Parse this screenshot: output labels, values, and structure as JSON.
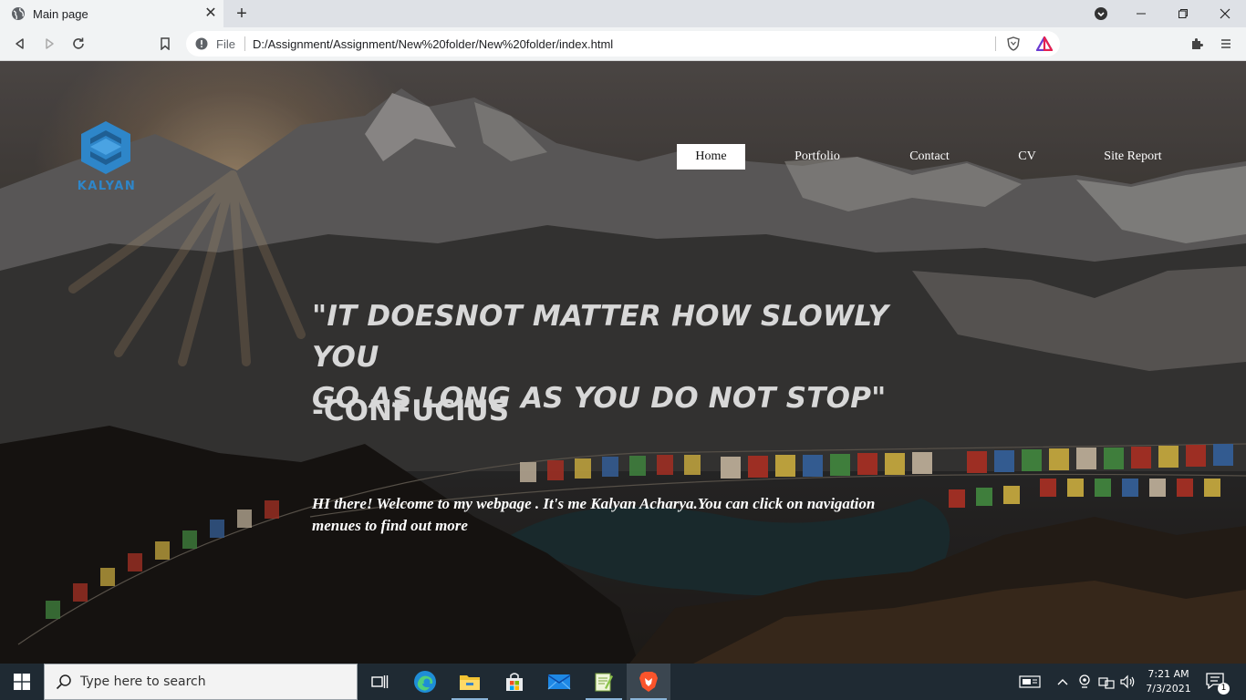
{
  "browser": {
    "tab": {
      "title": "Main page"
    },
    "address": {
      "scheme": "File",
      "url": "D:/Assignment/Assignment/New%20folder/New%20folder/index.html"
    }
  },
  "site": {
    "logo_text": "KALYAN",
    "nav": [
      {
        "label": "Home",
        "active": true
      },
      {
        "label": "Portfolio",
        "active": false
      },
      {
        "label": "Contact",
        "active": false
      },
      {
        "label": "CV",
        "active": false
      },
      {
        "label": "Site Report",
        "active": false
      }
    ],
    "quote_line1": "\"IT DOESNOT MATTER HOW SLOWLY YOU",
    "quote_line2": "GO AS LONG AS YOU DO NOT STOP\"",
    "author": "-CONFUCIUS",
    "welcome": "HI there! Welcome to my webpage . It's me Kalyan Acharya.You can click on navigation menues to find out more",
    "colors": {
      "logo": "#2e86c9",
      "nav_active_bg": "#ffffff",
      "quote": "#d8d8d8"
    }
  },
  "taskbar": {
    "search_placeholder": "Type here to search",
    "apps": [
      "task-view-icon",
      "edge-icon",
      "file-explorer-icon",
      "store-icon",
      "mail-icon",
      "notepad-plus-icon",
      "brave-icon"
    ],
    "clock_time": "7:21 AM",
    "clock_date": "7/3/2021",
    "notification_count": "1"
  }
}
